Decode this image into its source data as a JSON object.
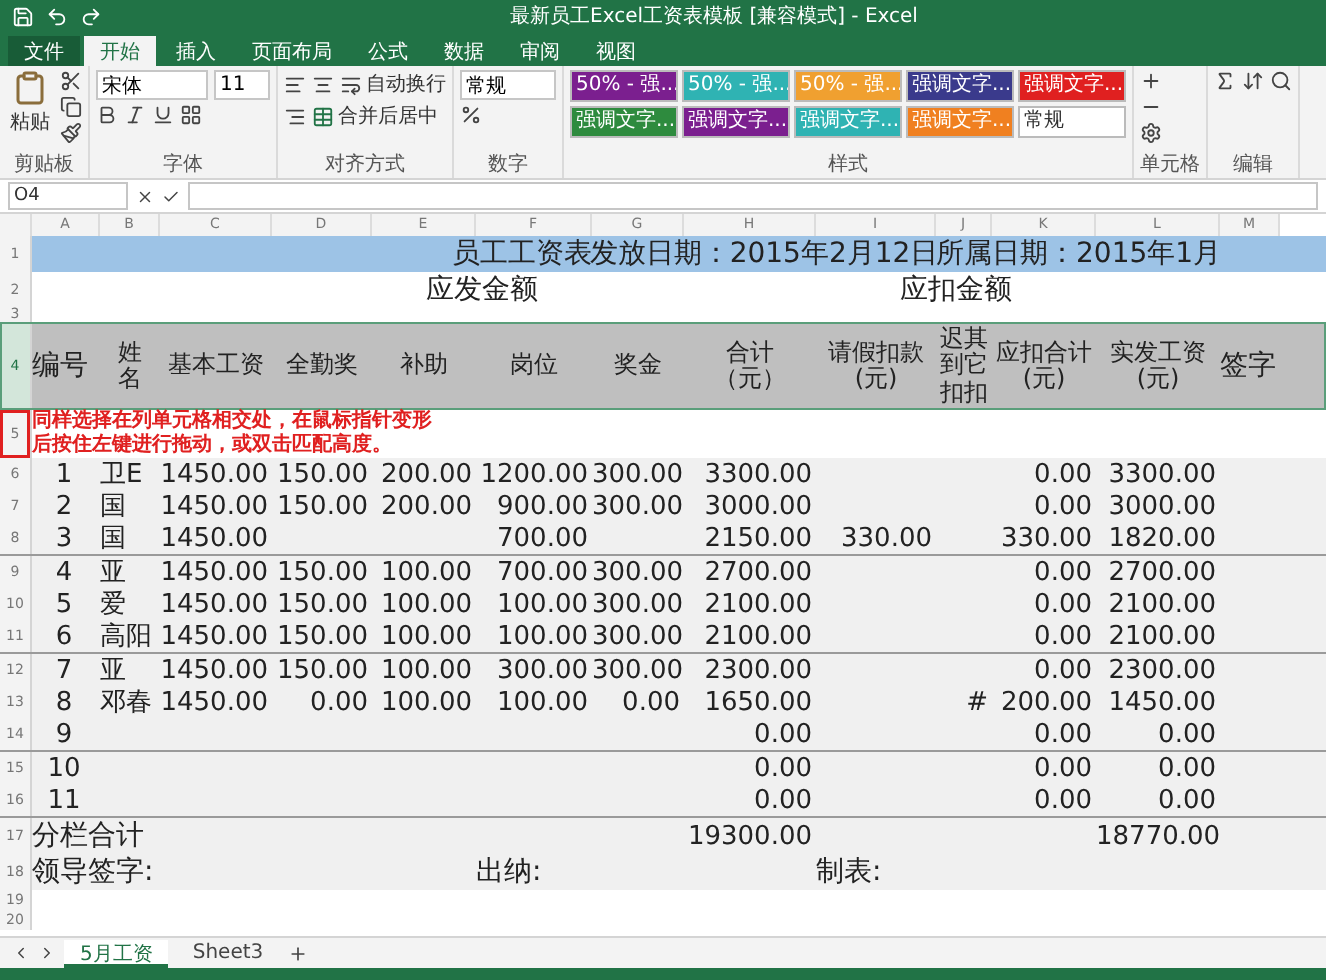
{
  "window": {
    "title": "最新员工Excel工资表模板 [兼容模式] - Excel"
  },
  "ribbon": {
    "tabs": [
      {
        "label": "文件",
        "selected": false,
        "kind": "file"
      },
      {
        "label": "开始",
        "selected": true,
        "kind": "tab"
      },
      {
        "label": "插入",
        "selected": false,
        "kind": "tab"
      },
      {
        "label": "页面布局",
        "selected": false,
        "kind": "tab"
      },
      {
        "label": "公式",
        "selected": false,
        "kind": "tab"
      },
      {
        "label": "数据",
        "selected": false,
        "kind": "tab"
      },
      {
        "label": "审阅",
        "selected": false,
        "kind": "tab"
      },
      {
        "label": "视图",
        "selected": false,
        "kind": "tab"
      }
    ],
    "clipboard": {
      "label": "剪贴板",
      "paste": "粘贴"
    },
    "font": {
      "label": "字体",
      "name": "宋体",
      "size": "11"
    },
    "alignment": {
      "label": "对齐方式",
      "wrap": "自动换行",
      "merge": "合并后居中"
    },
    "number": {
      "label": "数字",
      "format": "常规"
    },
    "styles": {
      "label": "样式",
      "chips": [
        {
          "text": "50% - 强...",
          "color": "#7b1f8f"
        },
        {
          "text": "50% - 强...",
          "color": "#2fb3b3"
        },
        {
          "text": "50% - 强...",
          "color": "#f0a030"
        },
        {
          "text": "强调文字...",
          "color": "#3a3a8c"
        },
        {
          "text": "强调文字...",
          "color": "#e02020"
        },
        {
          "text": "强调文字...",
          "color": "#2e8b3e"
        },
        {
          "text": "强调文字...",
          "color": "#7b1f8f"
        },
        {
          "text": "强调文字...",
          "color": "#2fb3b3"
        },
        {
          "text": "强调文字...",
          "color": "#f08020"
        },
        {
          "text": "常规",
          "color": "#ffffff"
        }
      ]
    },
    "cells": {
      "label": "单元格"
    },
    "editing": {
      "label": "编辑"
    }
  },
  "formula_bar": {
    "name_box": "O4"
  },
  "sheet": {
    "columns": [
      "A",
      "B",
      "C",
      "D",
      "E",
      "F",
      "G",
      "H",
      "I",
      "J",
      "K",
      "L",
      "M"
    ],
    "title_row": {
      "number": "1",
      "texts": [
        "员工工资表",
        "发放日期：2015年2月12日",
        "所属日期：2015年1月"
      ]
    },
    "group_row": {
      "numbers": [
        "2",
        "3"
      ],
      "labels": [
        "应发金额",
        "应扣金额"
      ]
    },
    "header_row": {
      "number": "4",
      "selected": true,
      "cells": [
        "编号",
        "姓名",
        "基本工资",
        "全勤奖",
        "补助",
        "岗位",
        "奖金",
        "合计（元）",
        "请假扣款(元)",
        "迟其到它扣扣",
        "应扣合计(元)",
        "实发工资(元)",
        "签字"
      ]
    },
    "annotation": {
      "number": "5",
      "marked": true,
      "lines": [
        "同样选择在列单元格相交处，在鼠标指针变形",
        "后按住左键进行拖动，或双击匹配高度。"
      ]
    },
    "rows": [
      {
        "number": "6",
        "group_end": false,
        "cells": [
          "1",
          "卫E",
          "1450.00",
          "150.00",
          "200.00",
          "1200.00",
          "300.00",
          "3300.00",
          null,
          null,
          "0.00",
          "3300.00",
          null
        ]
      },
      {
        "number": "7",
        "group_end": false,
        "cells": [
          "2",
          "国",
          "1450.00",
          "150.00",
          "200.00",
          "900.00",
          "300.00",
          "3000.00",
          null,
          null,
          "0.00",
          "3000.00",
          null
        ]
      },
      {
        "number": "8",
        "group_end": true,
        "cells": [
          "3",
          "国",
          "1450.00",
          null,
          null,
          "700.00",
          null,
          "2150.00",
          "330.00",
          null,
          "330.00",
          "1820.00",
          null
        ]
      },
      {
        "number": "9",
        "group_end": false,
        "cells": [
          "4",
          "亚",
          "1450.00",
          "150.00",
          "100.00",
          "700.00",
          "300.00",
          "2700.00",
          null,
          null,
          "0.00",
          "2700.00",
          null
        ]
      },
      {
        "number": "10",
        "group_end": false,
        "cells": [
          "5",
          "爱",
          "1450.00",
          "150.00",
          "100.00",
          "100.00",
          "300.00",
          "2100.00",
          null,
          null,
          "0.00",
          "2100.00",
          null
        ]
      },
      {
        "number": "11",
        "group_end": true,
        "cells": [
          "6",
          "高阳",
          "1450.00",
          "150.00",
          "100.00",
          "100.00",
          "300.00",
          "2100.00",
          null,
          null,
          "0.00",
          "2100.00",
          null
        ]
      },
      {
        "number": "12",
        "group_end": false,
        "cells": [
          "7",
          "亚",
          "1450.00",
          "150.00",
          "100.00",
          "300.00",
          "300.00",
          "2300.00",
          null,
          null,
          "0.00",
          "2300.00",
          null
        ]
      },
      {
        "number": "13",
        "group_end": false,
        "cells": [
          "8",
          "邓春",
          "1450.00",
          "0.00",
          "100.00",
          "100.00",
          "0.00",
          "1650.00",
          null,
          "#",
          "200.00",
          "1450.00",
          null
        ]
      },
      {
        "number": "14",
        "group_end": true,
        "cells": [
          "9",
          null,
          null,
          null,
          null,
          null,
          null,
          "0.00",
          null,
          null,
          "0.00",
          "0.00",
          null
        ]
      },
      {
        "number": "15",
        "group_end": false,
        "cells": [
          "10",
          null,
          null,
          null,
          null,
          null,
          null,
          "0.00",
          null,
          null,
          "0.00",
          "0.00",
          null
        ]
      },
      {
        "number": "16",
        "group_end": true,
        "cells": [
          "11",
          null,
          null,
          null,
          null,
          null,
          null,
          "0.00",
          null,
          null,
          "0.00",
          "0.00",
          null
        ]
      }
    ],
    "total_row": {
      "number": "17",
      "label": "分栏合计",
      "total": "19300.00",
      "net": "18770.00"
    },
    "sign_row": {
      "number": "18",
      "labels": [
        "领导签字:",
        "出纳:",
        "制表:"
      ]
    },
    "empty_rows": [
      "19",
      "20"
    ]
  },
  "sheet_tabs": [
    {
      "label": "5月工资",
      "selected": true
    },
    {
      "label": "Sheet3",
      "selected": false
    }
  ]
}
